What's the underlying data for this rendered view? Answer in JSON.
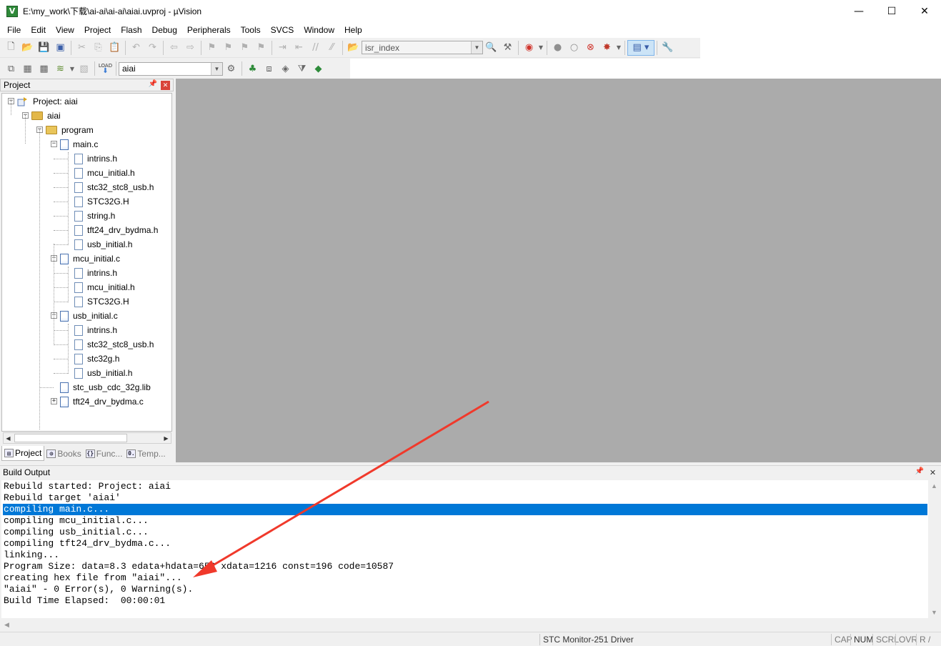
{
  "window": {
    "title": "E:\\my_work\\下载\\ai-ai\\ai-ai\\aiai.uvproj - µVision",
    "app_icon_letter": "V",
    "minimize": "—",
    "maximize": "☐",
    "close": "✕"
  },
  "menu": [
    "File",
    "Edit",
    "View",
    "Project",
    "Flash",
    "Debug",
    "Peripherals",
    "Tools",
    "SVCS",
    "Window",
    "Help"
  ],
  "toolbar1": {
    "find_combo_value": "isr_index"
  },
  "toolbar2": {
    "target_combo_value": "aiai",
    "load_label": "LOAD"
  },
  "project_panel": {
    "title": "Project",
    "pin": "ᵖ",
    "close": "✕",
    "tree": {
      "root": "Project: aiai",
      "target": "aiai",
      "group": "program",
      "files": [
        {
          "name": "main.c",
          "children": [
            "intrins.h",
            "mcu_initial.h",
            "stc32_stc8_usb.h",
            "STC32G.H",
            "string.h",
            "tft24_drv_bydma.h",
            "usb_initial.h"
          ]
        },
        {
          "name": "mcu_initial.c",
          "children": [
            "intrins.h",
            "mcu_initial.h",
            "STC32G.H"
          ]
        },
        {
          "name": "usb_initial.c",
          "children": [
            "intrins.h",
            "stc32_stc8_usb.h",
            "stc32g.h",
            "usb_initial.h"
          ]
        },
        {
          "name": "stc_usb_cdc_32g.lib",
          "children": []
        },
        {
          "name": "tft24_drv_bydma.c",
          "children": []
        }
      ]
    },
    "tabs": [
      {
        "label": "Project",
        "icon_text": "▤"
      },
      {
        "label": "Books",
        "icon_text": "◍"
      },
      {
        "label": "Func...",
        "icon_text": "{}"
      },
      {
        "label": "Temp...",
        "icon_text": "0."
      }
    ]
  },
  "build_output": {
    "title": "Build Output",
    "selected_index": 2,
    "lines": [
      "Rebuild started: Project: aiai",
      "Rebuild target 'aiai'",
      "compiling main.c...",
      "compiling mcu_initial.c...",
      "compiling usb_initial.c...",
      "compiling tft24_drv_bydma.c...",
      "linking...",
      "Program Size: data=8.3 edata+hdata=653 xdata=1216 const=196 code=10587",
      "creating hex file from \"aiai\"...",
      "\"aiai\" - 0 Error(s), 0 Warning(s).",
      "Build Time Elapsed:  00:00:01"
    ]
  },
  "status_bar": {
    "driver": "STC Monitor-251 Driver",
    "cap": "CAP",
    "num": "NUM",
    "scrl": "SCRL",
    "ovr": "OVR",
    "rw": "R /"
  },
  "annotation": {
    "arrow_color": "#f0392b"
  }
}
